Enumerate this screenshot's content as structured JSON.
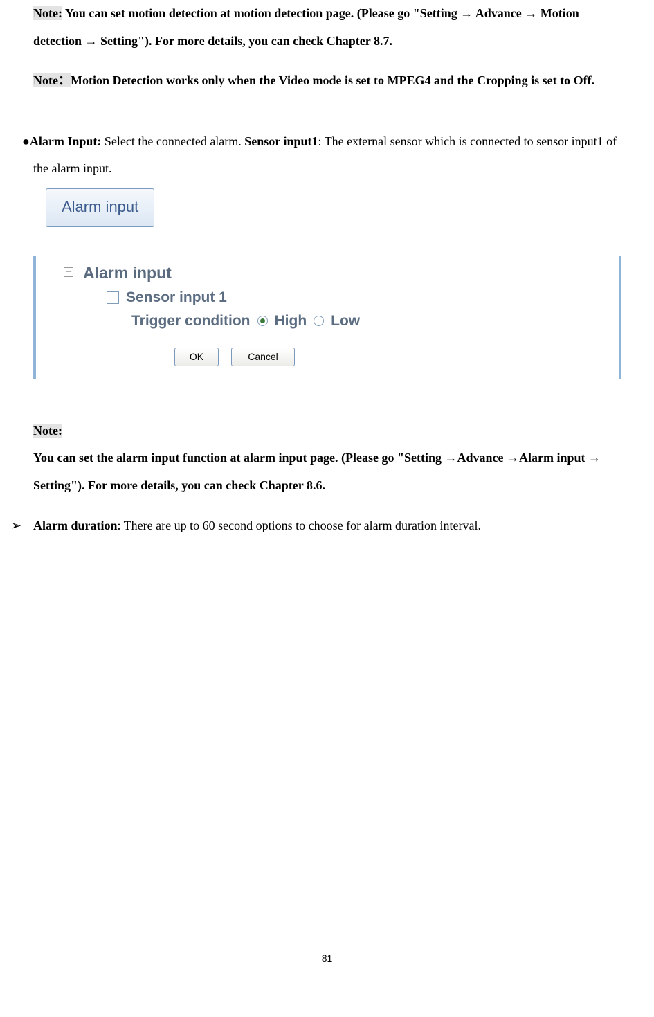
{
  "note1": {
    "label": "Note:",
    "text1": " You can set motion detection at motion detection page. (Please go \"Setting → Advance → Motion detection → Setting\"). For more details, you can check Chapter 8.7."
  },
  "note2": {
    "label": "Note",
    "colon": "：",
    "text": "Motion Detection works only when the Video mode is set to MPEG4 and the Cropping is set to Off."
  },
  "alarm_input": {
    "bullet": "●",
    "label": "Alarm Input:",
    "text1": " Select the connected alarm. ",
    "sensor_label": "Sensor input1",
    "text2": ": The external sensor which is connected to sensor input1 of the alarm input."
  },
  "btn_graphic": "Alarm input",
  "panel": {
    "heading": "Alarm input",
    "item": "Sensor input 1",
    "trigger_label": "Trigger condition",
    "high": "High",
    "low": "Low",
    "ok": "OK",
    "cancel": "Cancel"
  },
  "note3": {
    "label": "Note:",
    "text": "You can set the alarm input function at alarm input page. (Please go \"Setting →Advance →Alarm input → Setting\"). For more details, you can check Chapter 8.6."
  },
  "alarm_duration": {
    "arrow": "➢",
    "label": "Alarm duration",
    "text": ": There are up to 60 second options to choose for alarm duration interval."
  },
  "page_number": "81"
}
